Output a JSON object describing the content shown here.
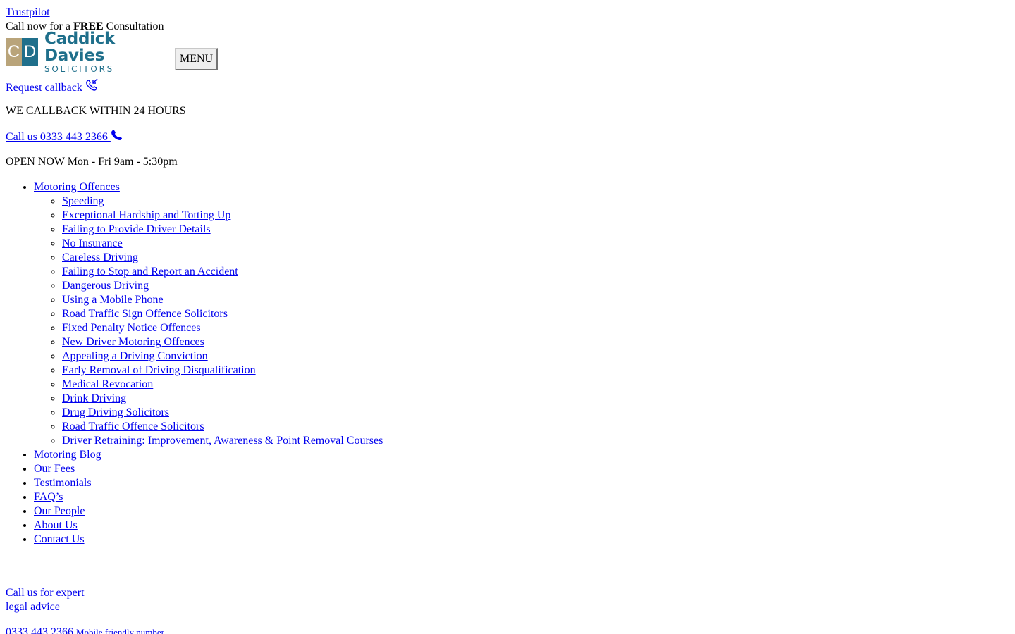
{
  "top": {
    "trustpilot": "Trustpilot",
    "consult_pre": "Call now for a ",
    "consult_bold": "FREE",
    "consult_post": " Consultation"
  },
  "logo": {
    "mark_left": "C",
    "mark_right": "D",
    "name": "Caddick Davies",
    "sub": "SOLICITORS",
    "colors": {
      "gold": "#b9a47a",
      "teal": "#1f6f8b"
    }
  },
  "menu_button": "MENU",
  "callback": {
    "link": "Request callback ",
    "icon": "phone-callback-icon",
    "note": "WE CALLBACK WITHIN 24 HOURS"
  },
  "call": {
    "link": "Call us 0333 443 2366 ",
    "icon": "phone-icon",
    "open": "OPEN NOW Mon - Fri 9am - 5:30pm"
  },
  "nav": {
    "motoring": "Motoring Offences",
    "sub": [
      "Speeding",
      "Exceptional Hardship and Totting Up",
      "Failing to Provide Driver Details",
      "No Insurance",
      "Careless Driving",
      "Failing to Stop and Report an Accident",
      "Dangerous Driving",
      "Using a Mobile Phone",
      "Road Traffic Sign Offence Solicitors",
      "Fixed Penalty Notice Offences",
      "New Driver Motoring Offences",
      "Appealing a Driving Conviction",
      "Early Removal of Driving Disqualification",
      "Medical Revocation",
      "Drink Driving",
      "Drug Driving Solicitors",
      "Road Traffic Offence Solicitors",
      "Driver Retraining: Improvement, Awareness & Point Removal Courses"
    ],
    "items": [
      "Motoring Blog",
      "Our Fees",
      "Testimonials",
      "FAQ’s",
      "Our People",
      "About Us",
      "Contact Us"
    ]
  },
  "expert": {
    "line1": "Call us for expert",
    "line2": "legal advice"
  },
  "phone": {
    "number": "0333 443 2366",
    "mobile": "Mobile friendly number"
  },
  "link_color": "#0000ee"
}
